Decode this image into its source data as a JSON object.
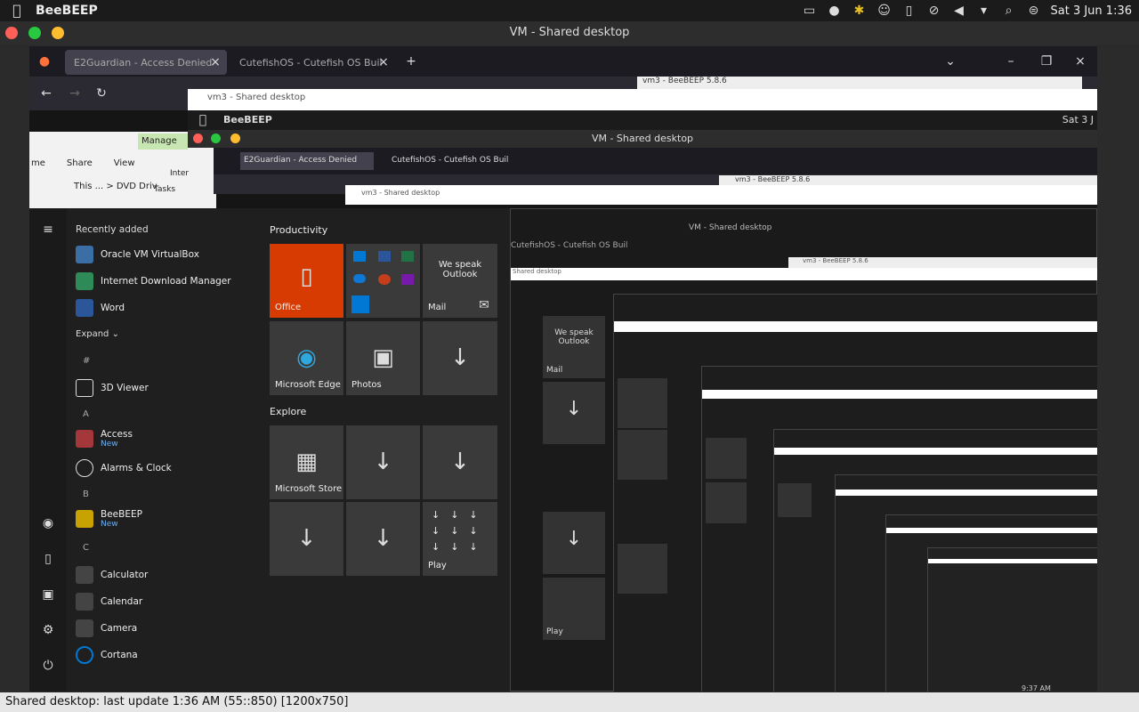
{
  "topbar": {
    "app_name": "BeeBEEP",
    "datetime": "Sat 3 Jun 1:36",
    "icons": [
      "battery-icon",
      "user-icon",
      "bee-icon",
      "users-icon",
      "clipboard-icon",
      "mute-icon",
      "volume-icon",
      "dropdown-icon",
      "search-icon",
      "toggle-icon"
    ]
  },
  "window": {
    "title": "VM - Shared desktop",
    "controls": {
      "close": "#ff5f57",
      "minimize": "#28c840",
      "maximize": "#febc2e"
    }
  },
  "browser": {
    "tabs": [
      {
        "label": "E2Guardian - Access Denied",
        "active": true
      },
      {
        "label": "CutefishOS - Cutefish OS Buil",
        "active": false
      }
    ],
    "beebeep_window": "vm3 - BeeBEEP 5.8.6",
    "shared_desktop_title": "vm3 - Shared desktop"
  },
  "explorer": {
    "manage": "Manage",
    "menu": [
      "me",
      "Share",
      "View"
    ],
    "path": "This ... > DVD Driv",
    "tasks": "Tasks",
    "internet": "Inter"
  },
  "inner": {
    "app_name": "BeeBEEP",
    "datetime": "Sat 3 J",
    "title": "VM - Shared desktop",
    "tabs": [
      {
        "label": "E2Guardian - Access Denied"
      },
      {
        "label": "CutefishOS - Cutefish OS Buil"
      }
    ],
    "beebeep_window": "vm3 - BeeBEEP 5.8.6",
    "shared_desktop_title": "vm3 - Shared desktop"
  },
  "start_menu": {
    "recently_added": "Recently added",
    "expand": "Expand",
    "apps": [
      {
        "label": "Oracle VM VirtualBox",
        "color": "#3a6ea5"
      },
      {
        "label": "Internet Download Manager",
        "color": "#2e8b57"
      },
      {
        "label": "Word",
        "color": "#2b579a"
      },
      {
        "label": "3D Viewer",
        "color": "#555555"
      },
      {
        "label": "Access",
        "sub": "New",
        "color": "#a4373a"
      },
      {
        "label": "Alarms & Clock",
        "color": "#555555"
      },
      {
        "label": "BeeBEEP",
        "sub": "New",
        "color": "#c8a200"
      },
      {
        "label": "Calculator",
        "color": "#444444"
      },
      {
        "label": "Calendar",
        "color": "#444444"
      },
      {
        "label": "Camera",
        "color": "#444444"
      },
      {
        "label": "Cortana",
        "color": "#0078d4"
      }
    ],
    "letters": [
      "#",
      "A",
      "B",
      "C"
    ],
    "groups": {
      "productivity": "Productivity",
      "explore": "Explore"
    },
    "tiles": {
      "office": "Office",
      "we_speak": "We speak Outlook",
      "mail": "Mail",
      "edge": "Microsoft Edge",
      "photos": "Photos",
      "store": "Microsoft Store",
      "play": "Play"
    }
  },
  "nested": {
    "title": "VM - Shared desktop",
    "tab": "CutefishOS - Cutefish OS Buil",
    "beebeep": "vm3 - BeeBEEP 5.8.6",
    "shared": "Shared desktop",
    "we_speak": "We speak Outlook",
    "mail": "Mail",
    "play": "Play",
    "time": "9:37 AM"
  },
  "status": "Shared desktop: last update 1:36 AM (55::850) [1200x750]"
}
